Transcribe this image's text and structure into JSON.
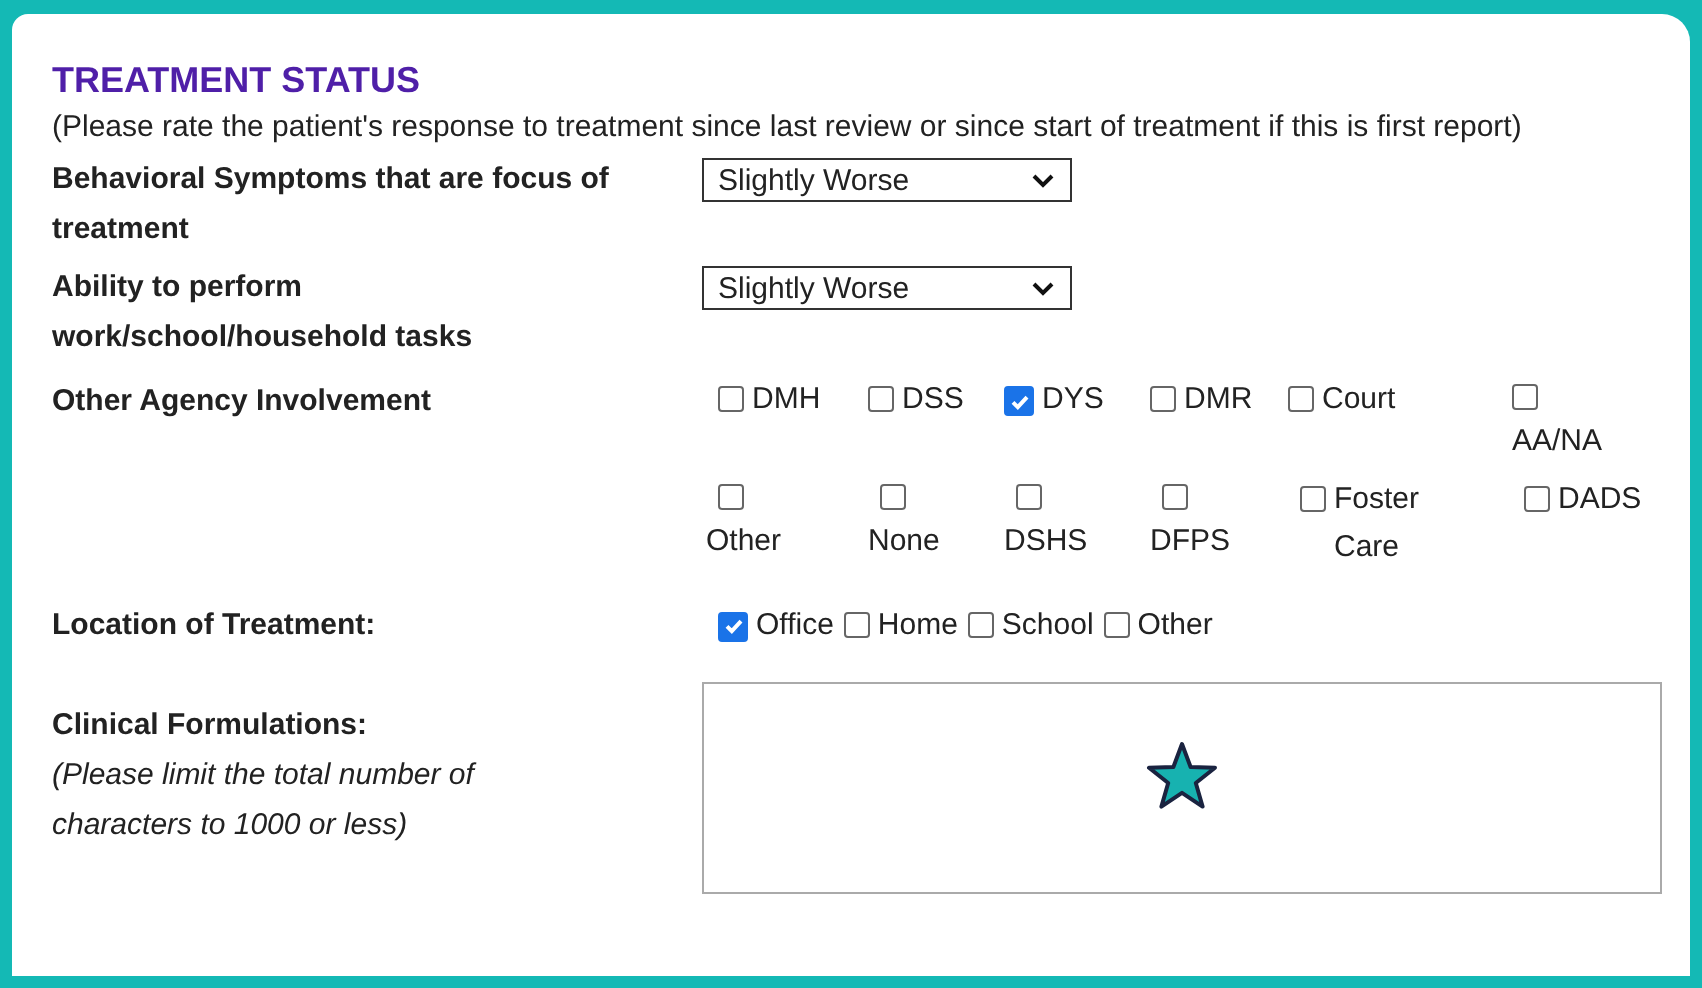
{
  "section": {
    "title": "TREATMENT STATUS",
    "note": "(Please rate the patient's response to treatment since last review or since start of treatment if this is first report)"
  },
  "fields": [
    {
      "label": "Behavioral Symptoms that are focus of treatment",
      "value": "Slightly Worse"
    },
    {
      "label": "Ability to perform work/school/household tasks",
      "value": "Slightly Worse"
    }
  ],
  "agency": {
    "label": "Other Agency Involvement",
    "options": [
      {
        "label": "DMH",
        "checked": false,
        "kind": "inline"
      },
      {
        "label": "DSS",
        "checked": false,
        "kind": "inline"
      },
      {
        "label": "DYS",
        "checked": true,
        "kind": "inline"
      },
      {
        "label": "DMR",
        "checked": false,
        "kind": "inline"
      },
      {
        "label": "Court",
        "checked": false,
        "kind": "inline"
      },
      {
        "label": "AA/NA",
        "checked": false,
        "kind": "stacked"
      },
      {
        "label": "Other",
        "checked": false,
        "kind": "stacked"
      },
      {
        "label": "None",
        "checked": false,
        "kind": "stacked"
      },
      {
        "label": "DSHS",
        "checked": false,
        "kind": "stacked"
      },
      {
        "label": "DFPS",
        "checked": false,
        "kind": "stacked"
      },
      {
        "label": "Foster Care",
        "checked": false,
        "kind": "inline"
      },
      {
        "label": "DADS",
        "checked": false,
        "kind": "inline"
      }
    ]
  },
  "location": {
    "label": "Location of Treatment:",
    "options": [
      {
        "label": "Office",
        "checked": true
      },
      {
        "label": "Home",
        "checked": false
      },
      {
        "label": "School",
        "checked": false
      },
      {
        "label": "Other",
        "checked": false
      }
    ]
  },
  "formulations": {
    "label": "Clinical Formulations:",
    "hint": "(Please limit the total number of characters to 1000 or less)"
  }
}
